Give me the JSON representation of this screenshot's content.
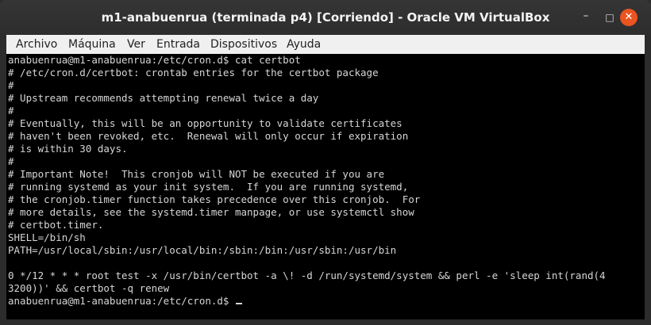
{
  "window": {
    "title": "m1-anabuenrua (terminada p4) [Corriendo] - Oracle VM VirtualBox",
    "minimize_glyph": "–",
    "maximize_glyph": "□",
    "close_glyph": "✕"
  },
  "menu": {
    "items": [
      "Archivo",
      "Máquina",
      "Ver",
      "Entrada",
      "Dispositivos",
      "Ayuda"
    ]
  },
  "terminal": {
    "lines": [
      "anabuenrua@m1-anabuenrua:/etc/cron.d$ cat certbot",
      "# /etc/cron.d/certbot: crontab entries for the certbot package",
      "#",
      "# Upstream recommends attempting renewal twice a day",
      "#",
      "# Eventually, this will be an opportunity to validate certificates",
      "# haven't been revoked, etc.  Renewal will only occur if expiration",
      "# is within 30 days.",
      "#",
      "# Important Note!  This cronjob will NOT be executed if you are",
      "# running systemd as your init system.  If you are running systemd,",
      "# the cronjob.timer function takes precedence over this cronjob.  For",
      "# more details, see the systemd.timer manpage, or use systemctl show",
      "# certbot.timer.",
      "SHELL=/bin/sh",
      "PATH=/usr/local/sbin:/usr/local/bin:/sbin:/bin:/usr/sbin:/usr/bin",
      "",
      "0 */12 * * * root test -x /usr/bin/certbot -a \\! -d /run/systemd/system && perl -e 'sleep int(rand(4",
      "3200))' && certbot -q renew",
      "anabuenrua@m1-anabuenrua:/etc/cron.d$ "
    ]
  },
  "colors": {
    "titlebar": "#2d2d2d",
    "close_button": "#e95420",
    "menubar": "#f0f0f0",
    "terminal_bg": "#000000",
    "terminal_fg": "#d6d6d6"
  }
}
